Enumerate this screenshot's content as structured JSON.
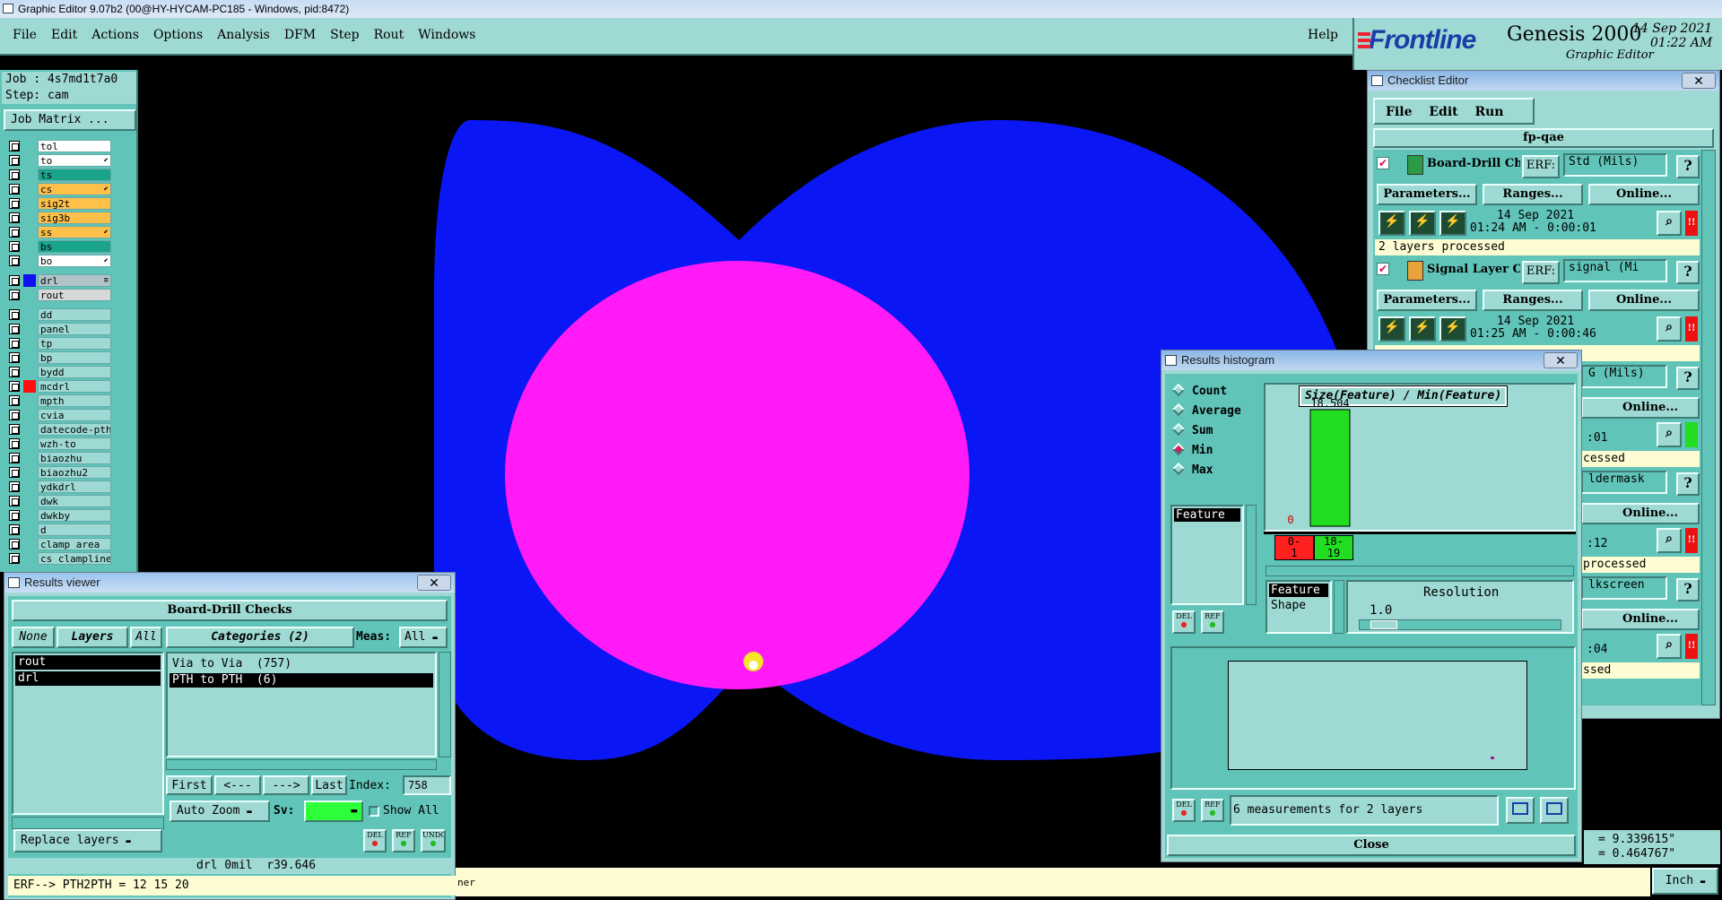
{
  "window": {
    "title": "Graphic Editor 9.07b2 (00@HY-HYCAM-PC185 - Windows, pid:8472)"
  },
  "menu": {
    "items": [
      "File",
      "Edit",
      "Actions",
      "Options",
      "Analysis",
      "DFM",
      "Step",
      "Rout",
      "Windows"
    ],
    "help": "Help"
  },
  "brand": {
    "logo": "Frontline",
    "product": "Genesis 2000",
    "subtitle": "Graphic Editor",
    "date": "14 Sep 2021",
    "time": "01:22 AM"
  },
  "job": {
    "job_label": "Job : 4s7md1t7a0",
    "step_label": "Step: cam",
    "matrix_button": "Job Matrix ..."
  },
  "layers": [
    {
      "name": "tol",
      "color": "#ffffff",
      "mark": ""
    },
    {
      "name": "to",
      "color": "#ffffff",
      "mark": "⬋"
    },
    {
      "name": "ts",
      "color": "#1aa58a",
      "mark": ""
    },
    {
      "name": "cs",
      "color": "#ffc04a",
      "mark": "⬋"
    },
    {
      "name": "sig2t",
      "color": "#ffc04a",
      "mark": ""
    },
    {
      "name": "sig3b",
      "color": "#ffc04a",
      "mark": ""
    },
    {
      "name": "ss",
      "color": "#ffc04a",
      "mark": "⬋"
    },
    {
      "name": "bs",
      "color": "#1aa58a",
      "mark": ""
    },
    {
      "name": "bo",
      "color": "#ffffff",
      "mark": "⬋"
    },
    {
      "name": "drl",
      "color": "#b0c4c8",
      "mark": "≡",
      "swatch": "#1010f0"
    },
    {
      "name": "rout",
      "color": "#d8d8d8",
      "mark": ""
    },
    {
      "name": "dd",
      "color": "#9fd9d3",
      "mark": ""
    },
    {
      "name": "panel",
      "color": "#9fd9d3",
      "mark": ""
    },
    {
      "name": "tp",
      "color": "#9fd9d3",
      "mark": ""
    },
    {
      "name": "bp",
      "color": "#9fd9d3",
      "mark": ""
    },
    {
      "name": "bydd",
      "color": "#9fd9d3",
      "mark": ""
    },
    {
      "name": "mcdrl",
      "color": "#9fd9d3",
      "mark": "",
      "swatch": "#ff1010"
    },
    {
      "name": "mpth",
      "color": "#9fd9d3",
      "mark": ""
    },
    {
      "name": "cvia",
      "color": "#9fd9d3",
      "mark": ""
    },
    {
      "name": "datecode-pth",
      "color": "#9fd9d3",
      "mark": ""
    },
    {
      "name": "wzh-to",
      "color": "#9fd9d3",
      "mark": ""
    },
    {
      "name": "biaozhu",
      "color": "#9fd9d3",
      "mark": ""
    },
    {
      "name": "biaozhu2",
      "color": "#9fd9d3",
      "mark": ""
    },
    {
      "name": "ydkdrl",
      "color": "#9fd9d3",
      "mark": ""
    },
    {
      "name": "dwk",
      "color": "#9fd9d3",
      "mark": ""
    },
    {
      "name": "dwkby",
      "color": "#9fd9d3",
      "mark": ""
    },
    {
      "name": "d",
      "color": "#9fd9d3",
      "mark": ""
    },
    {
      "name": "clamp_area",
      "color": "#9fd9d3",
      "mark": ""
    },
    {
      "name": "cs_clampline",
      "color": "#9fd9d3",
      "mark": ""
    }
  ],
  "results_viewer": {
    "title": "Results viewer",
    "header": "Board-Drill Checks",
    "none_btn": "None",
    "layers_btn": "Layers",
    "all_btn": "All",
    "categories_label": "Categories (2)",
    "meas_label": "Meas:",
    "meas_value": "All",
    "layer_items": [
      "rout",
      "drl"
    ],
    "categories": [
      "Via to Via  (757)",
      "PTH to PTH  (6)"
    ],
    "first": "First",
    "prev": "<---",
    "next": "--->",
    "last": "Last",
    "index_label": "Index:",
    "index_value": "758",
    "auto_zoom": "Auto Zoom",
    "sv_label": "Sv:",
    "show_all": "Show All",
    "replace_layers": "Replace layers",
    "del": "DEL",
    "ref": "REF",
    "undo": "UNDO",
    "status": "drl 0mil  r39.646",
    "erf": "ERF--> PTH2PTH = 12 15 20"
  },
  "checklist": {
    "title": "Checklist Editor",
    "menu": [
      "File",
      "Edit",
      "Run"
    ],
    "name": "fp-qae",
    "checks": [
      {
        "name": "Board-Drill Checks",
        "erf": "ERF:",
        "erf_value": "Std (Mils)",
        "date": "14 Sep 2021",
        "time": "01:24 AM - 0:00:01",
        "status": "2 layers processed"
      },
      {
        "name": "Signal Layer Checks",
        "erf": "ERF:",
        "erf_value": "signal (Mi",
        "date": "14 Sep 2021",
        "time": "01:25 AM - 0:00:46",
        "status": ""
      }
    ],
    "parameters": "Parameters...",
    "ranges": "Ranges...",
    "online": "Online...",
    "partial_right": [
      {
        "erf": "G (Mils)",
        "time": ":01",
        "status": "cessed"
      },
      {
        "erf": "ldermask",
        "time": ":12",
        "status": "processed"
      },
      {
        "erf": "lkscreen",
        "time": ":04",
        "status": "ssed"
      }
    ]
  },
  "histogram": {
    "title": "Results histogram",
    "modes": [
      "Count",
      "Average",
      "Sum",
      "Min",
      "Max"
    ],
    "selected_mode": "Min",
    "field": "Feature",
    "chart_title": "Size(Feature) / Min(Feature)",
    "bins": [
      {
        "label_top": "0-",
        "label_bot": "1",
        "value": 0,
        "color": "#ff2020"
      },
      {
        "label_top": "18-",
        "label_bot": "19",
        "value": 18.504,
        "color": "#22dd22"
      }
    ],
    "value_labels": [
      "0",
      "18.504"
    ],
    "attr_items": [
      "Feature",
      "Shape"
    ],
    "resolution_label": "Resolution",
    "resolution_value": "1.0",
    "del": "DEL",
    "ref": "REF",
    "measurements": "6 measurements for 2 layers",
    "close": "Close"
  },
  "coords": {
    "x": "= 9.339615\"",
    "y": "= 0.464767\""
  },
  "units": "Inch",
  "bottom_msg": "ner",
  "chart_data": {
    "type": "bar",
    "title": "Size(Feature) / Min(Feature)",
    "categories": [
      "0-1",
      "18-19"
    ],
    "values": [
      0,
      18.504
    ],
    "ylim": [
      0,
      18.504
    ],
    "xlabel": "",
    "ylabel": ""
  }
}
